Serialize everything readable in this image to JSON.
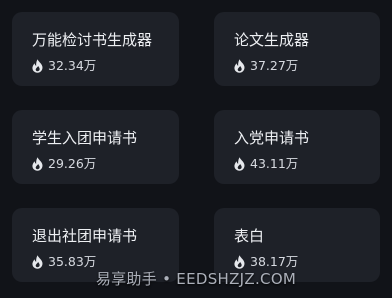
{
  "cards": [
    {
      "title": "万能检讨书生成器",
      "count": "32.34万"
    },
    {
      "title": "论文生成器",
      "count": "37.27万"
    },
    {
      "title": "学生入团申请书",
      "count": "29.26万"
    },
    {
      "title": "入党申请书",
      "count": "43.11万"
    },
    {
      "title": "退出社团申请书",
      "count": "35.83万"
    },
    {
      "title": "表白",
      "count": "38.17万"
    }
  ],
  "watermark": "易享助手 • EEDSHZJZ.COM",
  "icons": {
    "hot": "flame-icon"
  },
  "colors": {
    "background": "#111318",
    "card": "#1e2128",
    "text": "#eef0f3"
  }
}
